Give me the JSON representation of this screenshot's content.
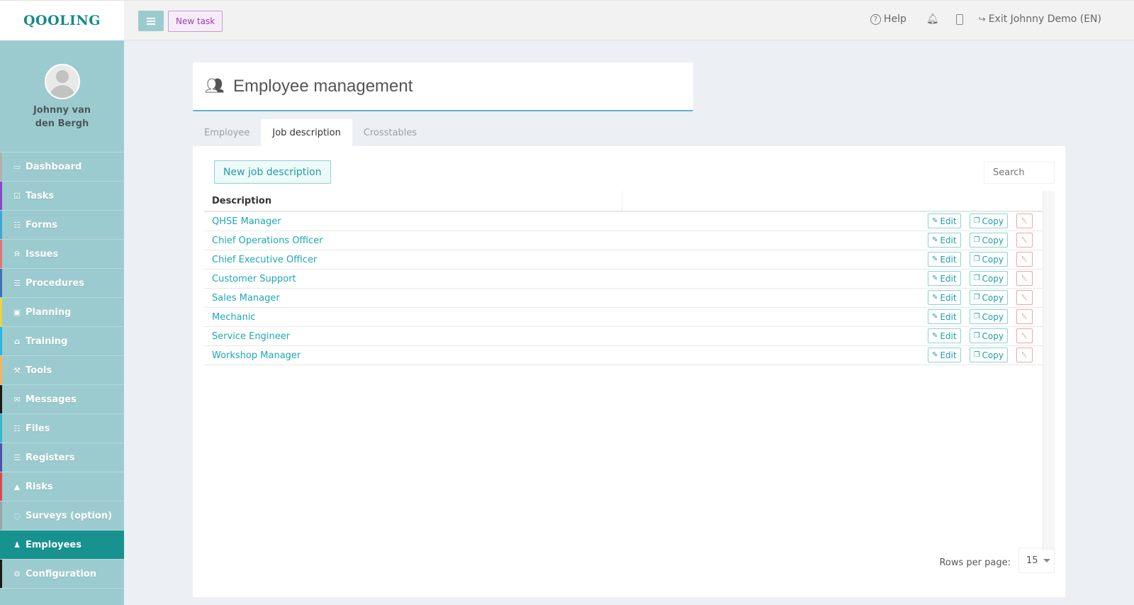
{
  "app": {
    "logo": "QOOLING"
  },
  "topbar": {
    "new_task": "New task",
    "help": "Help",
    "exit": "Exit Johnny Demo (EN)"
  },
  "profile": {
    "name": "Johnny van den Bergh"
  },
  "sidebar": {
    "items": [
      {
        "label": "Dashboard",
        "icon": "monitor-icon",
        "color": "#b0b0b0"
      },
      {
        "label": "Tasks",
        "icon": "checkbox-icon",
        "color": "#8e44c7"
      },
      {
        "label": "Forms",
        "icon": "file-icon",
        "color": "#3aa9d6"
      },
      {
        "label": "Issues",
        "icon": "bell-icon",
        "color": "#e8726f"
      },
      {
        "label": "Procedures",
        "icon": "list-icon",
        "color": "#3f6fb5"
      },
      {
        "label": "Planning",
        "icon": "calendar-icon",
        "color": "#f0d23a"
      },
      {
        "label": "Training",
        "icon": "graduation-cap-icon",
        "color": "#2ab6e0"
      },
      {
        "label": "Tools",
        "icon": "wrench-icon",
        "color": "#f5b35a"
      },
      {
        "label": "Messages",
        "icon": "envelope-icon",
        "color": "#1a1a1a"
      },
      {
        "label": "Files",
        "icon": "pdf-icon",
        "color": "#39b5d0"
      },
      {
        "label": "Registers",
        "icon": "list-icon",
        "color": "#4d4fae"
      },
      {
        "label": "Risks",
        "icon": "warning-icon",
        "color": "#e04848"
      },
      {
        "label": "Surveys (option)",
        "icon": "comment-icon",
        "color": "#9aa5a8"
      },
      {
        "label": "Employees",
        "icon": "users-icon",
        "color": "#17928f",
        "active": true
      },
      {
        "label": "Configuration",
        "icon": "gear-icon",
        "color": "#1a1a1a"
      }
    ]
  },
  "page": {
    "title": "Employee management"
  },
  "tabs": [
    {
      "label": "Employee",
      "active": false
    },
    {
      "label": "Job description",
      "active": true
    },
    {
      "label": "Crosstables",
      "active": false
    }
  ],
  "toolbar": {
    "new_job": "New job description",
    "search_placeholder": "Search"
  },
  "table": {
    "column": "Description",
    "rows": [
      "QHSE Manager",
      "Chief Operations Officer",
      "Chief Executive Officer",
      "Customer Support",
      "Sales Manager",
      "Mechanic",
      "Service Engineer",
      "Workshop Manager"
    ],
    "edit_label": "Edit",
    "copy_label": "Copy"
  },
  "pagination": {
    "rows_per_page_label": "Rows per page:",
    "rows_per_page": "15"
  },
  "colors": {
    "accent": "#17928f",
    "link": "#1ea8b2",
    "sidebar": "#9ccbcf"
  }
}
